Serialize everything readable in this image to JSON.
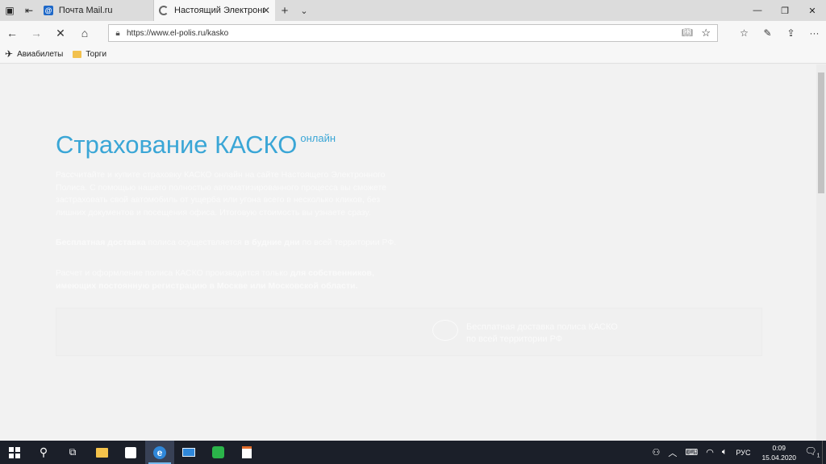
{
  "browser": {
    "tabs": [
      {
        "title": "Почта Mail.ru",
        "icon": "mail-ru-favicon"
      },
      {
        "title": "Настоящий Электронн",
        "icon": "loading-spinner-icon"
      }
    ],
    "url": "https://www.el-polis.ru/kasko",
    "favorites": [
      {
        "label": "Авиабилеты",
        "icon": "airplane-icon"
      },
      {
        "label": "Торги",
        "icon": "folder-icon"
      }
    ]
  },
  "page": {
    "title": "Страхование КАСКО",
    "title_suffix": "онлайн",
    "intro": "Рассчитайте и купите страховку КАСКО онлайн на сайте Настоящего Электронного Полиса. С помощью нашего полностью автоматизированного процесса вы сможете застраховать свой автомобиль от ущерба или угона всего в несколько кликов, без лишних документов и посещения офиса. Итоговую стоимость вы узнаете сразу.",
    "delivery_prefix": "Бесплатная доставка",
    "delivery_mid": " полиса осуществляется ",
    "delivery_bold": "в будние дни",
    "delivery_suffix": " по всей территории РФ.",
    "calc_prefix": "Расчет и оформление полиса КАСКО производится только ",
    "calc_bold": "для собственников, имеющих постоянную регистрацию в Москве или Московской области.",
    "info_text": "Бесплатная доставка полиса КАСКО по всей территории РФ"
  },
  "taskbar": {
    "lang": "РУС",
    "time": "0:09",
    "date": "15.04.2020",
    "notifications": "1"
  }
}
